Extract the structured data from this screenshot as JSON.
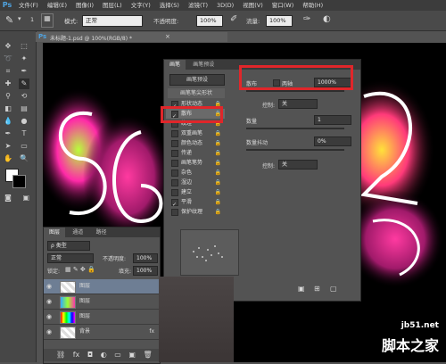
{
  "menubar": {
    "logo": "Ps",
    "items": [
      "文件(F)",
      "编辑(E)",
      "图像(I)",
      "图层(L)",
      "文字(Y)",
      "选择(S)",
      "滤镜(T)",
      "3D(D)",
      "视图(V)",
      "窗口(W)",
      "帮助(H)"
    ]
  },
  "optbar": {
    "brush_size": "1",
    "mode_label": "模式:",
    "mode_value": "正常",
    "opacity_label": "不透明度:",
    "opacity_value": "100%",
    "flow_label": "流量:",
    "flow_value": "100%"
  },
  "document": {
    "tab_title": "未标题-1.psd @ 100%(RGB/8) *",
    "close": "×"
  },
  "brush_panel": {
    "tabs": [
      "画笔",
      "画笔预设"
    ],
    "preset_button": "画笔预设",
    "tip_shape_header": "画笔笔尖形状",
    "items": [
      {
        "label": "形状动态",
        "checked": true
      },
      {
        "label": "散布",
        "checked": true
      },
      {
        "label": "纹理",
        "checked": false
      },
      {
        "label": "双重画笔",
        "checked": false
      },
      {
        "label": "颜色动态",
        "checked": false
      },
      {
        "label": "传递",
        "checked": false
      },
      {
        "label": "画笔笔势",
        "checked": false
      },
      {
        "label": "杂色",
        "checked": false
      },
      {
        "label": "湿边",
        "checked": false
      },
      {
        "label": "建立",
        "checked": false
      },
      {
        "label": "平滑",
        "checked": true
      },
      {
        "label": "保护纹理",
        "checked": false
      }
    ],
    "scatter_label": "散布",
    "both_axes_label": "两轴",
    "scatter_value": "1000%",
    "control_label": "控制:",
    "control_value": "关",
    "count_label": "数量",
    "count_value": "1",
    "count_jitter_label": "数量抖动",
    "count_jitter_value": "0%",
    "control2_label": "控制:",
    "control2_value": "关"
  },
  "layers_panel": {
    "tabs": [
      "图层",
      "通道",
      "路径"
    ],
    "kind_label": "ρ 类型",
    "blend_mode": "正常",
    "opacity_label": "不透明度:",
    "opacity_value": "100%",
    "lock_label": "锁定:",
    "fill_label": "填充:",
    "fill_value": "100%",
    "layers": [
      {
        "name": "图层"
      },
      {
        "name": "图层"
      },
      {
        "name": "图层"
      },
      {
        "name": "背景"
      }
    ]
  },
  "watermark": {
    "site": "jb51.net",
    "brand": "脚本之家"
  },
  "colors": {
    "highlight_red": "#e0262a",
    "menubar_bg": "#3c3c3c",
    "panel_bg": "#535353"
  }
}
